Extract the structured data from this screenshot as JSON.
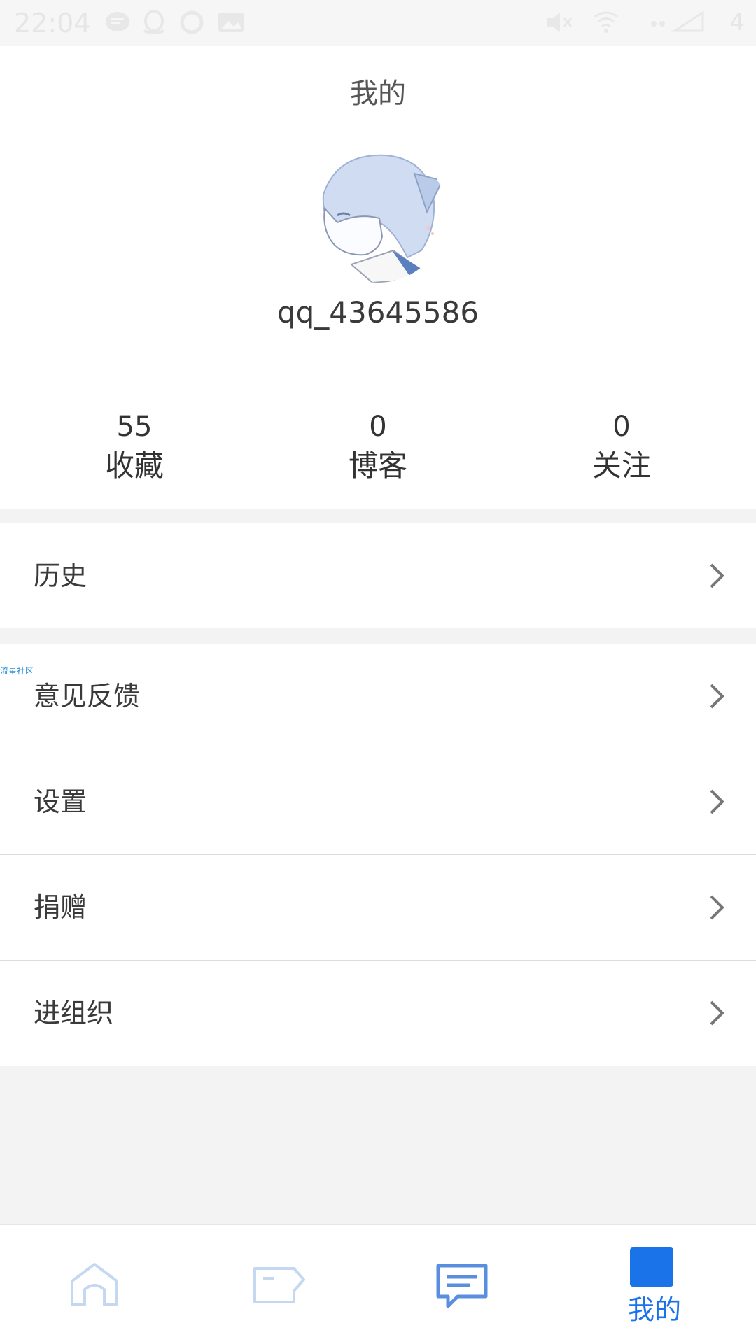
{
  "status_bar": {
    "time": "22:04",
    "battery": "4"
  },
  "header": {
    "title": "我的",
    "username": "qq_43645586"
  },
  "stats": [
    {
      "value": "55",
      "label": "收藏"
    },
    {
      "value": "0",
      "label": "博客"
    },
    {
      "value": "0",
      "label": "关注"
    }
  ],
  "menu": {
    "history": "历史",
    "feedback": "意见反馈",
    "settings": "设置",
    "donate": "捐赠",
    "join_org": "进组织"
  },
  "watermark": "流星社区",
  "bottom_nav": {
    "tabs": [
      {
        "icon": "home-icon",
        "label": ""
      },
      {
        "icon": "tag-icon",
        "label": ""
      },
      {
        "icon": "message-icon",
        "label": ""
      },
      {
        "icon": "profile-icon",
        "label": "我的"
      }
    ],
    "active_color": "#1a73e8",
    "inactive_color": "#c5d8f2"
  }
}
